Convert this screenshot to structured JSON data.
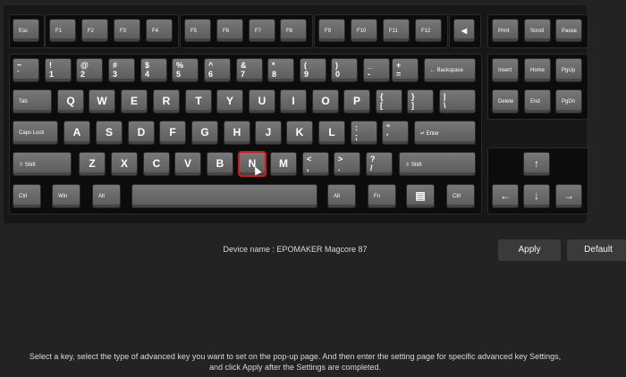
{
  "device": {
    "label": "Device name : EPOMAKER Magcore 87"
  },
  "buttons": {
    "apply": "Apply",
    "default": "Default"
  },
  "instructions": {
    "line1": "Select a key, select the type of advanced key you want to set on the pop-up page. And then enter the setting page for specific advanced key Settings,",
    "line2": "and click Apply after the Settings are completed."
  },
  "colors": {
    "selected_outline": "#d11a1a",
    "key_face": "#6a6a6a",
    "background": "#232323"
  },
  "selected_key": "N",
  "keyboard": {
    "keys": [
      {
        "id": "esc",
        "label": "Esc"
      },
      {
        "id": "f1",
        "label": "F1"
      },
      {
        "id": "f2",
        "label": "F2"
      },
      {
        "id": "f3",
        "label": "F3"
      },
      {
        "id": "f4",
        "label": "F4"
      },
      {
        "id": "f5",
        "label": "F5"
      },
      {
        "id": "f6",
        "label": "F6"
      },
      {
        "id": "f7",
        "label": "F7"
      },
      {
        "id": "f8",
        "label": "F8"
      },
      {
        "id": "f9",
        "label": "F9"
      },
      {
        "id": "f10",
        "label": "F10"
      },
      {
        "id": "f11",
        "label": "F11"
      },
      {
        "id": "f12",
        "label": "F12"
      },
      {
        "id": "knob",
        "label": "◂"
      },
      {
        "id": "print",
        "label": "Print"
      },
      {
        "id": "scroll",
        "label": "Scroll"
      },
      {
        "id": "pause",
        "label": "Pause"
      },
      {
        "id": "grave",
        "top": "~",
        "bottom": "`"
      },
      {
        "id": "1",
        "top": "!",
        "bottom": "1"
      },
      {
        "id": "2",
        "top": "@",
        "bottom": "2"
      },
      {
        "id": "3",
        "top": "#",
        "bottom": "3"
      },
      {
        "id": "4",
        "top": "$",
        "bottom": "4"
      },
      {
        "id": "5",
        "top": "%",
        "bottom": "5"
      },
      {
        "id": "6",
        "top": "^",
        "bottom": "6"
      },
      {
        "id": "7",
        "top": "&",
        "bottom": "7"
      },
      {
        "id": "8",
        "top": "*",
        "bottom": "8"
      },
      {
        "id": "9",
        "top": "(",
        "bottom": "9"
      },
      {
        "id": "0",
        "top": ")",
        "bottom": "0"
      },
      {
        "id": "minus",
        "top": "_",
        "bottom": "-"
      },
      {
        "id": "equal",
        "top": "+",
        "bottom": "="
      },
      {
        "id": "backspace",
        "label": "← Backspace"
      },
      {
        "id": "insert",
        "label": "Insert"
      },
      {
        "id": "home",
        "label": "Home"
      },
      {
        "id": "pgup",
        "label": "PgUp"
      },
      {
        "id": "tab",
        "label": "Tab"
      },
      {
        "id": "q",
        "label": "Q"
      },
      {
        "id": "w",
        "label": "W"
      },
      {
        "id": "e",
        "label": "E"
      },
      {
        "id": "r",
        "label": "R"
      },
      {
        "id": "t",
        "label": "T"
      },
      {
        "id": "y",
        "label": "Y"
      },
      {
        "id": "u",
        "label": "U"
      },
      {
        "id": "i",
        "label": "I"
      },
      {
        "id": "o",
        "label": "O"
      },
      {
        "id": "p",
        "label": "P"
      },
      {
        "id": "lbracket",
        "top": "{",
        "bottom": "["
      },
      {
        "id": "rbracket",
        "top": "}",
        "bottom": "]"
      },
      {
        "id": "backslash",
        "top": "|",
        "bottom": "\\"
      },
      {
        "id": "delete",
        "label": "Delete"
      },
      {
        "id": "end",
        "label": "End"
      },
      {
        "id": "pgdn",
        "label": "PgDn"
      },
      {
        "id": "caps",
        "label": "Caps Lock"
      },
      {
        "id": "a",
        "label": "A"
      },
      {
        "id": "s",
        "label": "S"
      },
      {
        "id": "d",
        "label": "D"
      },
      {
        "id": "f",
        "label": "F"
      },
      {
        "id": "g",
        "label": "G"
      },
      {
        "id": "h",
        "label": "H"
      },
      {
        "id": "j",
        "label": "J"
      },
      {
        "id": "k",
        "label": "K"
      },
      {
        "id": "l",
        "label": "L"
      },
      {
        "id": "semicolon",
        "top": ":",
        "bottom": ";"
      },
      {
        "id": "quote",
        "top": "\"",
        "bottom": "'"
      },
      {
        "id": "enter",
        "label": "↵ Enter"
      },
      {
        "id": "lshift",
        "label": "⇧ Shift"
      },
      {
        "id": "z",
        "label": "Z"
      },
      {
        "id": "x",
        "label": "X"
      },
      {
        "id": "c",
        "label": "C"
      },
      {
        "id": "v",
        "label": "V"
      },
      {
        "id": "b",
        "label": "B"
      },
      {
        "id": "n",
        "label": "N"
      },
      {
        "id": "m",
        "label": "M"
      },
      {
        "id": "comma",
        "top": "<",
        "bottom": ","
      },
      {
        "id": "period",
        "top": ">",
        "bottom": "."
      },
      {
        "id": "slash",
        "top": "?",
        "bottom": "/"
      },
      {
        "id": "rshift",
        "label": "⇧ Shift"
      },
      {
        "id": "up",
        "label": "↑"
      },
      {
        "id": "lctrl",
        "label": "Ctrl"
      },
      {
        "id": "win",
        "label": "Win"
      },
      {
        "id": "lalt",
        "label": "Alt"
      },
      {
        "id": "space",
        "label": ""
      },
      {
        "id": "ralt",
        "label": "Alt"
      },
      {
        "id": "fn",
        "label": "Fn"
      },
      {
        "id": "menu",
        "label": "▤"
      },
      {
        "id": "rctrl",
        "label": "Ctrl"
      },
      {
        "id": "left",
        "label": "←"
      },
      {
        "id": "down",
        "label": "↓"
      },
      {
        "id": "right",
        "label": "→"
      }
    ]
  }
}
